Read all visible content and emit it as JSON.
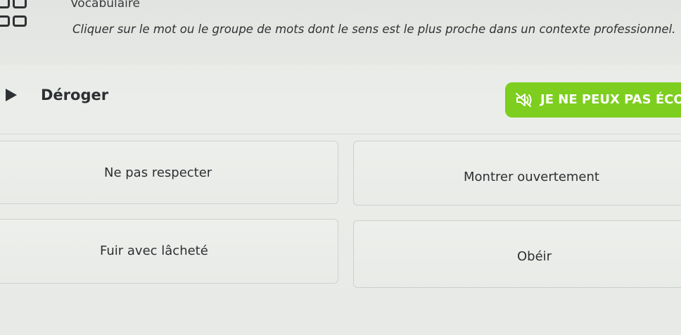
{
  "header": {
    "module_title": "Vocabulaire",
    "instruction": "Cliquer sur le mot ou le groupe de mots dont le sens est le plus proche dans un contexte professionnel."
  },
  "question": {
    "word": "Déroger",
    "cant_listen_label": "JE NE PEUX PAS ÉCOUTER"
  },
  "options": [
    {
      "label": "Ne pas respecter"
    },
    {
      "label": "Montrer ouvertement"
    },
    {
      "label": "Fuir avec lâcheté"
    },
    {
      "label": "Obéir"
    }
  ],
  "colors": {
    "accent_green": "#7dce1e",
    "text_dark": "#2d3032"
  },
  "icons": {
    "menu": "grid-icon",
    "play": "play-icon",
    "audio_off": "speaker-muted-icon"
  }
}
